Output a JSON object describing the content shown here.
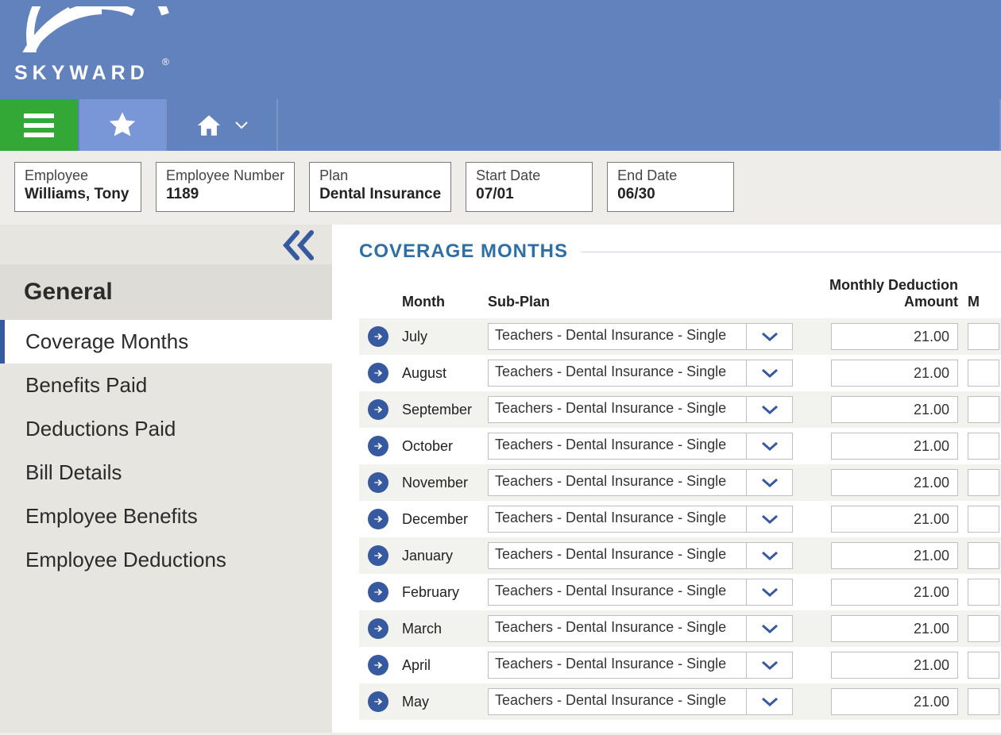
{
  "brand": {
    "name": "SKYWARD"
  },
  "info": {
    "employee_label": "Employee",
    "employee_value": "Williams, Tony",
    "empnum_label": "Employee Number",
    "empnum_value": "1189",
    "plan_label": "Plan",
    "plan_value": "Dental Insurance",
    "start_label": "Start Date",
    "start_value": "07/01",
    "end_label": "End Date",
    "end_value": "06/30"
  },
  "sidebar": {
    "header": "General",
    "items": [
      "Coverage Months",
      "Benefits Paid",
      "Deductions Paid",
      "Bill Details",
      "Employee Benefits",
      "Employee Deductions"
    ],
    "active_index": 0
  },
  "section_title": "COVERAGE MONTHS",
  "columns": {
    "month": "Month",
    "subplan": "Sub-Plan",
    "deduction": "Monthly Deduction Amount",
    "extra": "M"
  },
  "rows": [
    {
      "month": "July",
      "subplan": "Teachers - Dental Insurance - Single",
      "amount": "21.00"
    },
    {
      "month": "August",
      "subplan": "Teachers - Dental Insurance - Single",
      "amount": "21.00"
    },
    {
      "month": "September",
      "subplan": "Teachers - Dental Insurance - Single",
      "amount": "21.00"
    },
    {
      "month": "October",
      "subplan": "Teachers - Dental Insurance - Single",
      "amount": "21.00"
    },
    {
      "month": "November",
      "subplan": "Teachers - Dental Insurance - Single",
      "amount": "21.00"
    },
    {
      "month": "December",
      "subplan": "Teachers - Dental Insurance - Single",
      "amount": "21.00"
    },
    {
      "month": "January",
      "subplan": "Teachers - Dental Insurance - Single",
      "amount": "21.00"
    },
    {
      "month": "February",
      "subplan": "Teachers - Dental Insurance - Single",
      "amount": "21.00"
    },
    {
      "month": "March",
      "subplan": "Teachers - Dental Insurance - Single",
      "amount": "21.00"
    },
    {
      "month": "April",
      "subplan": "Teachers - Dental Insurance - Single",
      "amount": "21.00"
    },
    {
      "month": "May",
      "subplan": "Teachers - Dental Insurance - Single",
      "amount": "21.00"
    }
  ]
}
